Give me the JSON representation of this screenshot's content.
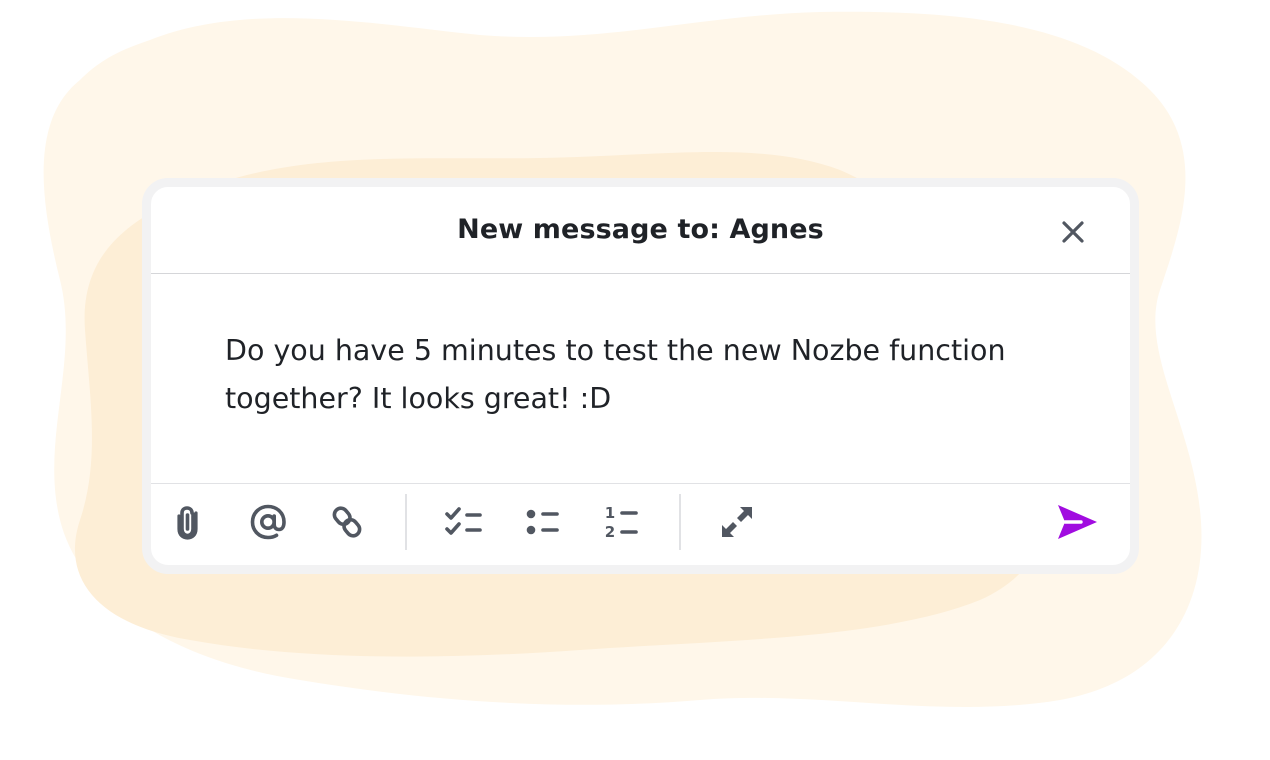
{
  "dialog": {
    "title": "New message to: Agnes",
    "close_icon": "close-icon",
    "message_lines": [
      "Do you have 5 minutes to test the new Nozbe function",
      "together? It looks great! :D"
    ]
  },
  "toolbar": {
    "tools": [
      {
        "name": "attach",
        "icon": "paperclip-icon"
      },
      {
        "name": "mention",
        "icon": "at-sign-icon"
      },
      {
        "name": "link",
        "icon": "link-icon"
      },
      {
        "name": "checklist",
        "icon": "checklist-icon"
      },
      {
        "name": "bullet-list",
        "icon": "bullet-list-icon"
      },
      {
        "name": "numbered-list",
        "icon": "numbered-list-icon",
        "numerals": [
          "1",
          "2"
        ]
      },
      {
        "name": "expand",
        "icon": "expand-arrows-icon"
      }
    ],
    "send_icon": "send-icon"
  },
  "colors": {
    "accent": "#a10ce0",
    "icon": "#515761",
    "text": "#1f2227",
    "backdrop": "#fdeed6",
    "dialog_border": "#f2f2f3"
  }
}
